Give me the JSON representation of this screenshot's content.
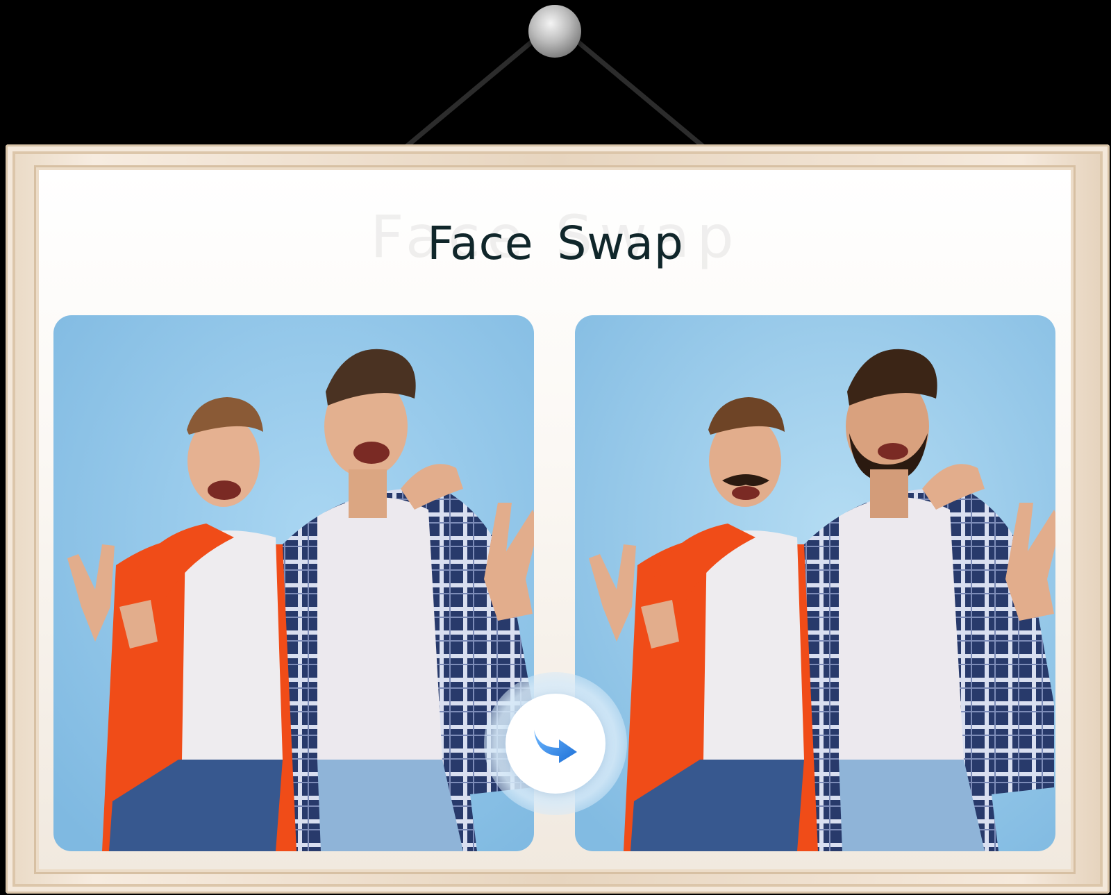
{
  "title": "Face Swap",
  "title_ghost": "Face Swap",
  "images": {
    "original": "photo-before",
    "result": "photo-after"
  },
  "icons": {
    "pin": "pushpin-icon",
    "swap": "swap-arrow-icon"
  },
  "colors": {
    "background": "#000000",
    "frame": "#efe2d2",
    "title": "#10262a",
    "photo_bg": "#8fc3e6",
    "accent_arrow": "#3a8ee8"
  }
}
